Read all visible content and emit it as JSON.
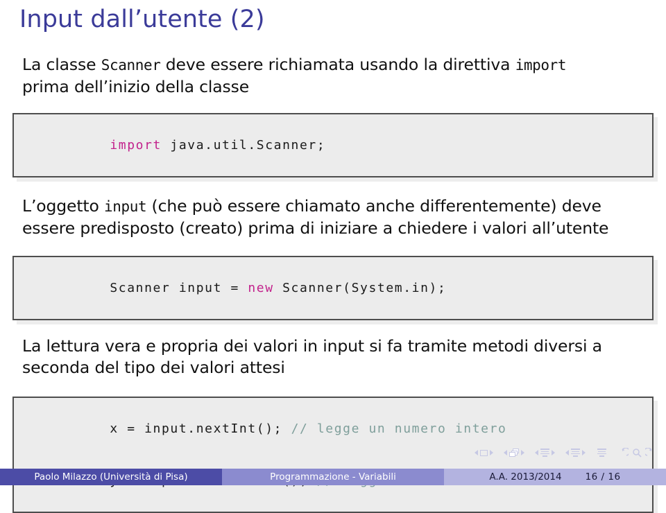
{
  "slide": {
    "title": "Input dall’utente (2)",
    "title_color": "#3b3b99"
  },
  "paragraphs": {
    "p1_a": "La classe ",
    "p1_tt1": "Scanner",
    "p1_b": " deve essere richiamata usando la direttiva ",
    "p1_tt2": "import",
    "p1_c": "",
    "p1_line2": "prima dell’inizio della classe",
    "p2_a": "L’oggetto ",
    "p2_tt1": "input",
    "p2_b": " (che può essere chiamato anche differentemente) deve",
    "p2_line2": "essere predisposto (creato) prima di iniziare a chiedere i valori all’utente",
    "p3_line1": "La lettura vera e propria dei valori in input si fa tramite metodi diversi a",
    "p3_line2": "seconda del tipo dei valori attesi"
  },
  "code_blocks": [
    {
      "id": "code-import",
      "lines": [
        [
          {
            "text": "import",
            "style": "keyword"
          },
          {
            "text": " java.util.Scanner;",
            "style": "plain"
          }
        ]
      ]
    },
    {
      "id": "code-scanner-init",
      "lines": [
        [
          {
            "text": "Scanner input = ",
            "style": "plain"
          },
          {
            "text": "new",
            "style": "keyword"
          },
          {
            "text": " Scanner(System.in);",
            "style": "plain"
          }
        ]
      ]
    },
    {
      "id": "code-read-values",
      "lines": [
        [
          {
            "text": "x = input.nextInt(); ",
            "style": "plain"
          },
          {
            "text": "// legge un numero intero",
            "style": "comment"
          }
        ],
        [
          {
            "text": "y = input.nextDouble(); ",
            "style": "plain"
          },
          {
            "text": "// legge un numero frazionario",
            "style": "comment"
          }
        ]
      ]
    }
  ],
  "code_colors": {
    "background": "#ececec",
    "border": "#4d4d4d",
    "text": "#1a1a1a",
    "keyword": "#c2228c",
    "comment": "#7f9f9b"
  },
  "navigation": {
    "items": [
      "frame-navigation",
      "subsection-navigation",
      "section-navigation",
      "presentation-navigation",
      "appendix-navigation",
      "back-arc",
      "search-magnifier",
      "forward-arc"
    ],
    "color": "#c6c8e4"
  },
  "footer": {
    "author": "Paolo Milazzo  (Università di Pisa)",
    "title": "Programmazione - Variabili",
    "date": "A.A. 2013/2014",
    "page": "16 / 16",
    "colors": {
      "author_bg": "#4c4ca6",
      "title_bg": "#8b8bcf",
      "date_bg": "#b3b3e0"
    }
  }
}
